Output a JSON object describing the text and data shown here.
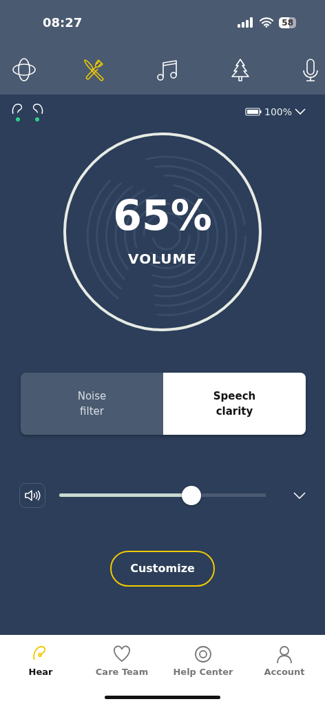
{
  "status_bar": {
    "time": "08:27",
    "battery": "58"
  },
  "programs": [
    {
      "kind": "ambient",
      "selected": false
    },
    {
      "kind": "restaurant",
      "selected": true
    },
    {
      "kind": "music",
      "selected": false
    },
    {
      "kind": "outdoor",
      "selected": false
    },
    {
      "kind": "microphone",
      "selected": false
    }
  ],
  "hearing_aids": [
    {
      "kind": "left",
      "connected": true
    },
    {
      "kind": "right",
      "connected": true
    }
  ],
  "device_battery": {
    "text": "100%"
  },
  "volume": {
    "value": "65%",
    "label": "VOLUME"
  },
  "modes": [
    {
      "label": "Noise\nfilter",
      "selected": false
    },
    {
      "label": "Speech\nclarity",
      "selected": true
    }
  ],
  "slider": {
    "level": 0.64
  },
  "customize_button": "Customize",
  "bottom_nav": [
    {
      "kind": "hear",
      "label": "Hear",
      "selected": true
    },
    {
      "kind": "care",
      "label": "Care Team",
      "selected": false
    },
    {
      "kind": "help",
      "label": "Help Center",
      "selected": false
    },
    {
      "kind": "account",
      "label": "Account",
      "selected": false
    }
  ]
}
